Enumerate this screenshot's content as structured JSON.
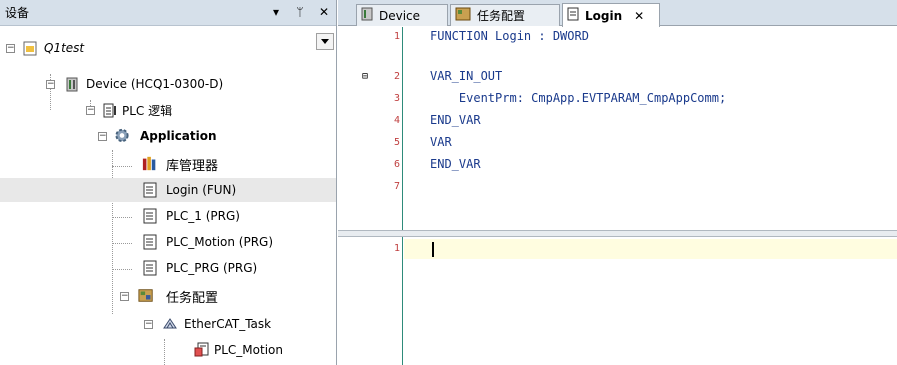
{
  "left_pane": {
    "title": "设备",
    "controls": [
      "▾",
      "ᛘ",
      "✕"
    ],
    "tree": [
      {
        "label": "Q1test",
        "icon": "project-icon"
      },
      {
        "label": "Device (HCQ1-0300-D)",
        "icon": "device-icon"
      },
      {
        "label": "PLC 逻辑",
        "icon": "plc-logic-icon"
      },
      {
        "label": "Application",
        "icon": "gear-icon"
      },
      {
        "label": "库管理器",
        "icon": "library-icon"
      },
      {
        "label": "Login (FUN)",
        "icon": "pou-icon"
      },
      {
        "label": "PLC_1 (PRG)",
        "icon": "pou-icon"
      },
      {
        "label": "PLC_Motion (PRG)",
        "icon": "pou-icon"
      },
      {
        "label": "PLC_PRG (PRG)",
        "icon": "pou-icon"
      },
      {
        "label": "任务配置",
        "icon": "task-config-icon"
      },
      {
        "label": "EtherCAT_Task",
        "icon": "task-icon"
      },
      {
        "label": "PLC_Motion",
        "icon": "program-call-icon"
      }
    ]
  },
  "editor": {
    "tabs": [
      {
        "label": "Device",
        "icon": "device-icon"
      },
      {
        "label": "任务配置",
        "icon": "task-config-icon"
      },
      {
        "label": "Login",
        "icon": "pou-icon",
        "close": "✕"
      }
    ],
    "declaration_lines": [
      {
        "num": "1",
        "text": "FUNCTION Login : DWORD"
      },
      {
        "num": "2",
        "text": "VAR_IN_OUT",
        "fold": "⊟"
      },
      {
        "num": "3",
        "text": "    EventPrm: CmpApp.EVTPARAM_CmpAppComm;"
      },
      {
        "num": "4",
        "text": "END_VAR"
      },
      {
        "num": "5",
        "text": "VAR"
      },
      {
        "num": "6",
        "text": "END_VAR"
      },
      {
        "num": "7",
        "text": ""
      }
    ],
    "implementation_lines": [
      {
        "num": "1",
        "text": ""
      }
    ]
  }
}
